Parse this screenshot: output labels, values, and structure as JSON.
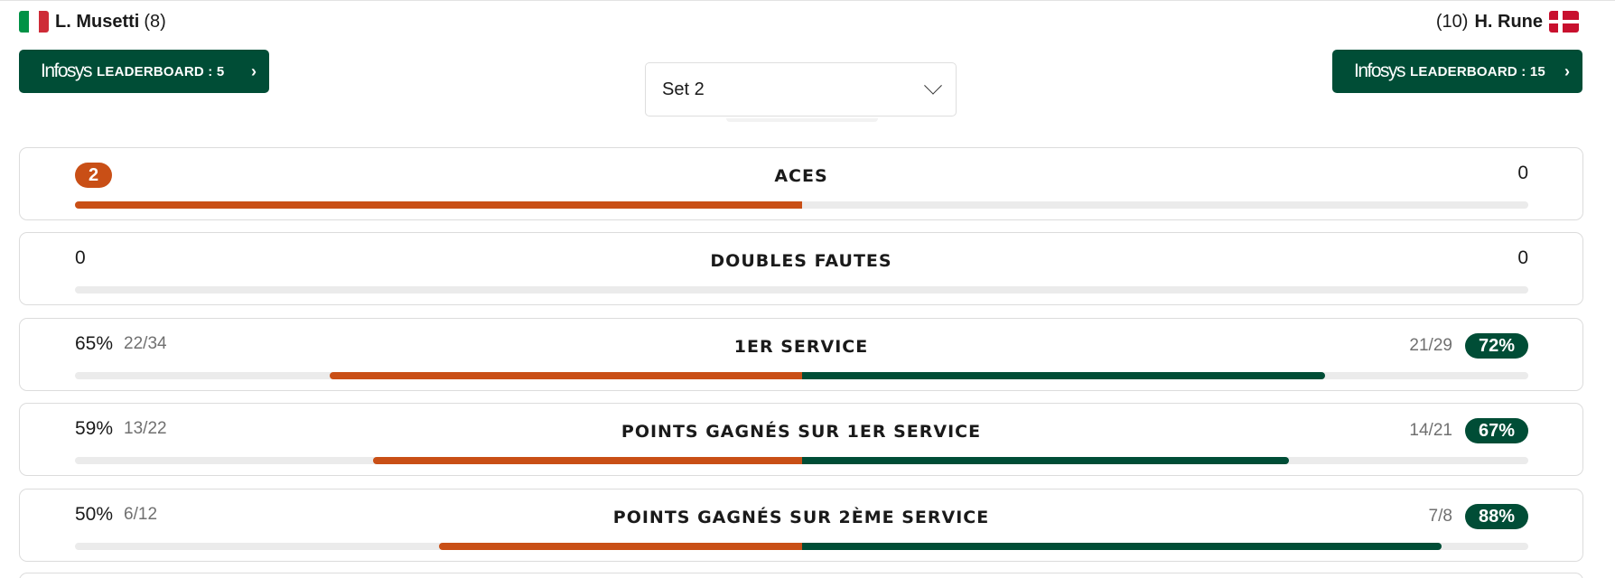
{
  "players": {
    "left": {
      "name": "L. Musetti",
      "seed": "(8)",
      "flag": "italy-flag"
    },
    "right": {
      "name": "H. Rune",
      "seed": "(10)",
      "flag": "denmark-flag"
    }
  },
  "leaderboard": {
    "brand": "Infosys",
    "left_label": "LEADERBOARD : 5",
    "right_label": "LEADERBOARD : 15",
    "chevron": "›"
  },
  "set_selector": {
    "selected": "Set 2"
  },
  "colors": {
    "left_player": "#c94f16",
    "right_player": "#004d36",
    "track": "#ebebeb"
  },
  "stats": [
    {
      "title": "ACES",
      "left_value": "2",
      "left_badge": true,
      "left_fraction": "",
      "right_value": "0",
      "right_badge": false,
      "right_fraction": "",
      "left_share": 1.0,
      "right_share": 0.0
    },
    {
      "title": "DOUBLES FAUTES",
      "left_value": "0",
      "left_badge": false,
      "left_fraction": "",
      "right_value": "0",
      "right_badge": false,
      "right_fraction": "",
      "left_share": 0.0,
      "right_share": 0.0
    },
    {
      "title": "1ER SERVICE",
      "left_value": "65%",
      "left_badge": false,
      "left_fraction": "22/34",
      "right_value": "72%",
      "right_badge": true,
      "right_fraction": "21/29",
      "left_share": 0.65,
      "right_share": 0.72
    },
    {
      "title": "POINTS GAGNÉS SUR 1ER SERVICE",
      "left_value": "59%",
      "left_badge": false,
      "left_fraction": "13/22",
      "right_value": "67%",
      "right_badge": true,
      "right_fraction": "14/21",
      "left_share": 0.59,
      "right_share": 0.67
    },
    {
      "title": "POINTS GAGNÉS SUR 2ÈME SERVICE",
      "left_value": "50%",
      "left_badge": false,
      "left_fraction": "6/12",
      "right_value": "88%",
      "right_badge": true,
      "right_fraction": "7/8",
      "left_share": 0.5,
      "right_share": 0.88
    }
  ]
}
